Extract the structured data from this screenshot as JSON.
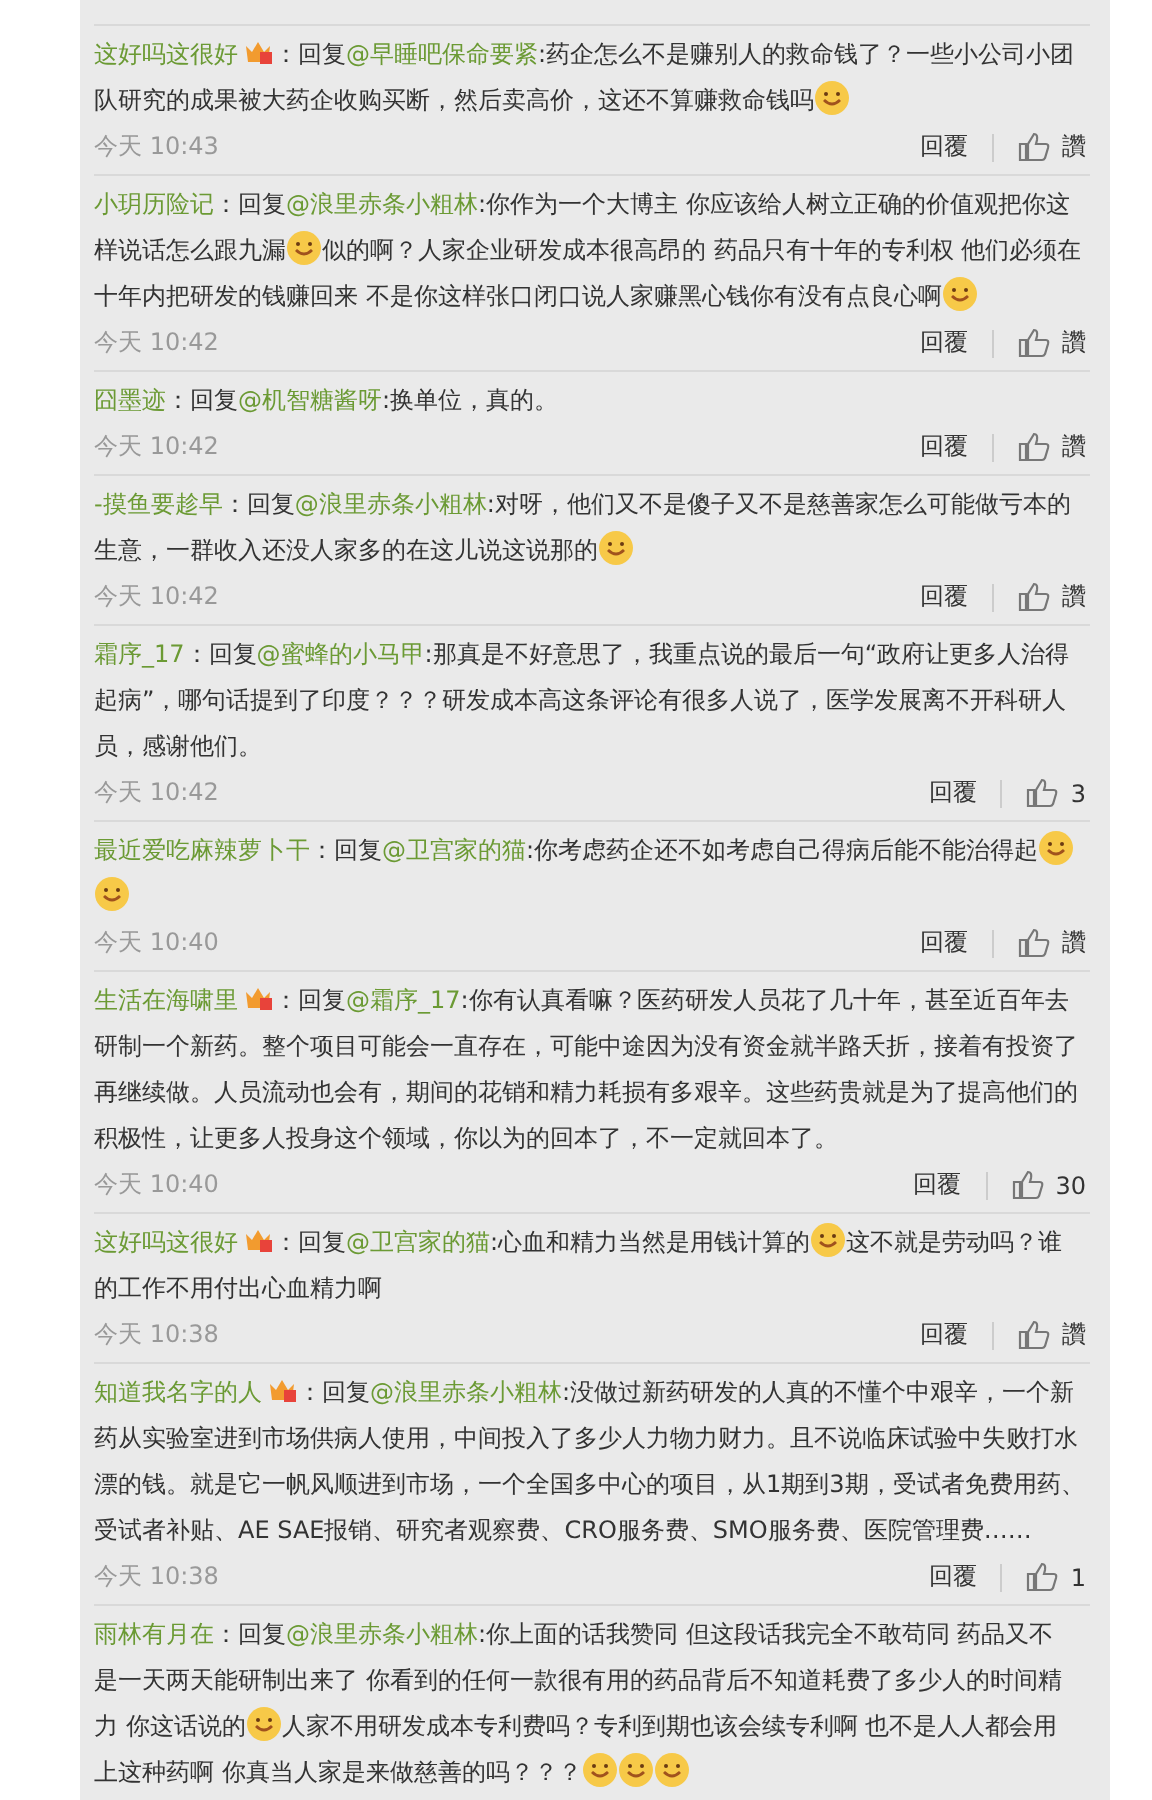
{
  "comments": [
    {
      "name": "这好吗这很好",
      "badge": true,
      "prefix": "：回复",
      "reply_to": "@早睡吧保命要紧",
      "content": [
        {
          "kind": "text",
          "text": ":药企怎么不是赚别人的救命钱了？一些小公司小团队研究的成果被大药企收购买断，然后卖高价，这还不算赚救命钱吗"
        },
        {
          "kind": "emoji"
        }
      ],
      "time": "今天 10:43",
      "reply": "回覆",
      "likes": "讚"
    },
    {
      "name": "小玥历险记",
      "badge": false,
      "prefix": "：回复",
      "reply_to": "@浪里赤条小粗林",
      "content": [
        {
          "kind": "text",
          "text": ":你作为一个大博主 你应该给人树立正确的价值观把你这样说话怎么跟九漏"
        },
        {
          "kind": "emoji"
        },
        {
          "kind": "text",
          "text": "似的啊？人家企业研发成本很高昂的 药品只有十年的专利权 他们必须在十年内把研发的钱赚回来 不是你这样张口闭口说人家赚黑心钱你有没有点良心啊"
        },
        {
          "kind": "emoji"
        }
      ],
      "time": "今天 10:42",
      "reply": "回覆",
      "likes": "讚"
    },
    {
      "name": "囧墨迹",
      "badge": false,
      "prefix": "：回复",
      "reply_to": "@机智糖酱呀",
      "content": [
        {
          "kind": "text",
          "text": ":换单位，真的。"
        }
      ],
      "time": "今天 10:42",
      "reply": "回覆",
      "likes": "讚"
    },
    {
      "name": "-摸鱼要趁早",
      "badge": false,
      "prefix": "：回复",
      "reply_to": "@浪里赤条小粗林",
      "content": [
        {
          "kind": "text",
          "text": ":对呀，他们又不是傻子又不是慈善家怎么可能做亏本的生意，一群收入还没人家多的在这儿说这说那的"
        },
        {
          "kind": "emoji"
        }
      ],
      "time": "今天 10:42",
      "reply": "回覆",
      "likes": "讚"
    },
    {
      "name": "霜序_17",
      "badge": false,
      "prefix": "：回复",
      "reply_to": "@蜜蜂的小马甲",
      "content": [
        {
          "kind": "text",
          "text": ":那真是不好意思了，我重点说的最后一句“政府让更多人治得起病”，哪句话提到了印度？？？研发成本高这条评论有很多人说了，医学发展离不开科研人员，感谢他们。"
        }
      ],
      "time": "今天 10:42",
      "reply": "回覆",
      "likes": "3"
    },
    {
      "name": "最近爱吃麻辣萝卜干",
      "badge": false,
      "prefix": "：回复",
      "reply_to": "@卫宫家的猫",
      "content": [
        {
          "kind": "text",
          "text": ":你考虑药企还不如考虑自己得病后能不能治得起"
        },
        {
          "kind": "emoji"
        },
        {
          "kind": "emoji"
        }
      ],
      "time": "今天 10:40",
      "reply": "回覆",
      "likes": "讚"
    },
    {
      "name": "生活在海啸里",
      "badge": true,
      "prefix": "：回复",
      "reply_to": "@霜序_17",
      "content": [
        {
          "kind": "text",
          "text": ":你有认真看嘛？医药研发人员花了几十年，甚至近百年去研制一个新药。整个项目可能会一直存在，可能中途因为没有资金就半路夭折，接着有投资了再继续做。人员流动也会有，期间的花销和精力耗损有多艰辛。这些药贵就是为了提高他们的积极性，让更多人投身这个领域，你以为的回本了，不一定就回本了。"
        }
      ],
      "time": "今天 10:40",
      "reply": "回覆",
      "likes": "30"
    },
    {
      "name": "这好吗这很好",
      "badge": true,
      "prefix": "：回复",
      "reply_to": "@卫宫家的猫",
      "content": [
        {
          "kind": "text",
          "text": ":心血和精力当然是用钱计算的"
        },
        {
          "kind": "emoji"
        },
        {
          "kind": "text",
          "text": "这不就是劳动吗？谁的工作不用付出心血精力啊"
        }
      ],
      "time": "今天 10:38",
      "reply": "回覆",
      "likes": "讚"
    },
    {
      "name": "知道我名字的人",
      "badge": true,
      "prefix": "：回复",
      "reply_to": "@浪里赤条小粗林",
      "content": [
        {
          "kind": "text",
          "text": ":没做过新药研发的人真的不懂个中艰辛，一个新药从实验室进到市场供病人使用，中间投入了多少人力物力财力。且不说临床试验中失败打水漂的钱。就是它一帆风顺进到市场，一个全国多中心的项目，从1期到3期，受试者免费用药、受试者补贴、AE SAE报销、研究者观察费、CRO服务费、SMO服务费、医院管理费……"
        }
      ],
      "time": "今天 10:38",
      "reply": "回覆",
      "likes": "1"
    },
    {
      "name": "雨林有月在",
      "badge": false,
      "prefix": "：回复",
      "reply_to": "@浪里赤条小粗林",
      "content": [
        {
          "kind": "text",
          "text": ":你上面的话我赞同  但这段话我完全不敢苟同  药品又不是一天两天能研制出来了  你看到的任何一款很有用的药品背后不知道耗费了多少人的时间精力  你这话说的"
        },
        {
          "kind": "emoji"
        },
        {
          "kind": "text",
          "text": "人家不用研发成本专利费吗？专利到期也该会续专利啊  也不是人人都会用上这种药啊  你真当人家是来做慈善的吗？？？"
        },
        {
          "kind": "emoji"
        },
        {
          "kind": "emoji"
        },
        {
          "kind": "emoji"
        }
      ]
    }
  ]
}
